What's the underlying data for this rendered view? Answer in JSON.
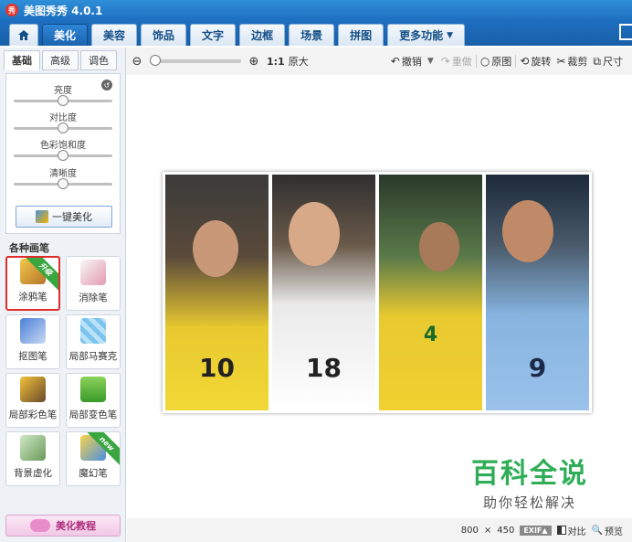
{
  "window": {
    "logo": "秀",
    "title": "美图秀秀 4.0.1"
  },
  "nav": {
    "tabs": [
      "美化",
      "美容",
      "饰品",
      "文字",
      "边框",
      "场景",
      "拼图"
    ],
    "more": "更多功能",
    "active_index": 0
  },
  "toolbar": {
    "ratio": "1:1",
    "origin_size": "原大",
    "undo": "撤销",
    "redo": "重做",
    "original": "原图",
    "rotate": "旋转",
    "crop": "裁剪",
    "size": "尺寸",
    "zoom_level": 0
  },
  "panel": {
    "subtabs": [
      "基础",
      "高级",
      "调色"
    ],
    "active_subtab": 0,
    "sliders": [
      {
        "label": "亮度",
        "value": 0.5
      },
      {
        "label": "对比度",
        "value": 0.5
      },
      {
        "label": "色彩饱和度",
        "value": 0.5
      },
      {
        "label": "清晰度",
        "value": 0.5
      }
    ],
    "one_click": "一键美化",
    "brush_heading": "各种画笔",
    "brushes": [
      {
        "label": "涂鸦笔",
        "badge": "升级",
        "selected": true
      },
      {
        "label": "消除笔",
        "badge": "",
        "selected": false
      },
      {
        "label": "抠图笔",
        "badge": "",
        "selected": false
      },
      {
        "label": "局部马赛克",
        "badge": "",
        "selected": false
      },
      {
        "label": "局部彩色笔",
        "badge": "",
        "selected": false
      },
      {
        "label": "局部变色笔",
        "badge": "",
        "selected": false
      },
      {
        "label": "背景虚化",
        "badge": "",
        "selected": false
      },
      {
        "label": "魔幻笔",
        "badge": "new",
        "selected": false
      }
    ],
    "tutorial": "美化教程"
  },
  "photo": {
    "jerseys": [
      "10",
      "18",
      "4",
      "9"
    ]
  },
  "watermark": {
    "title": "百科全说",
    "subtitle": "助你轻松解决"
  },
  "status": {
    "width": "800",
    "times": "×",
    "height": "450",
    "exif": "EXIF▲",
    "compare": "对比",
    "preview": "预览"
  }
}
